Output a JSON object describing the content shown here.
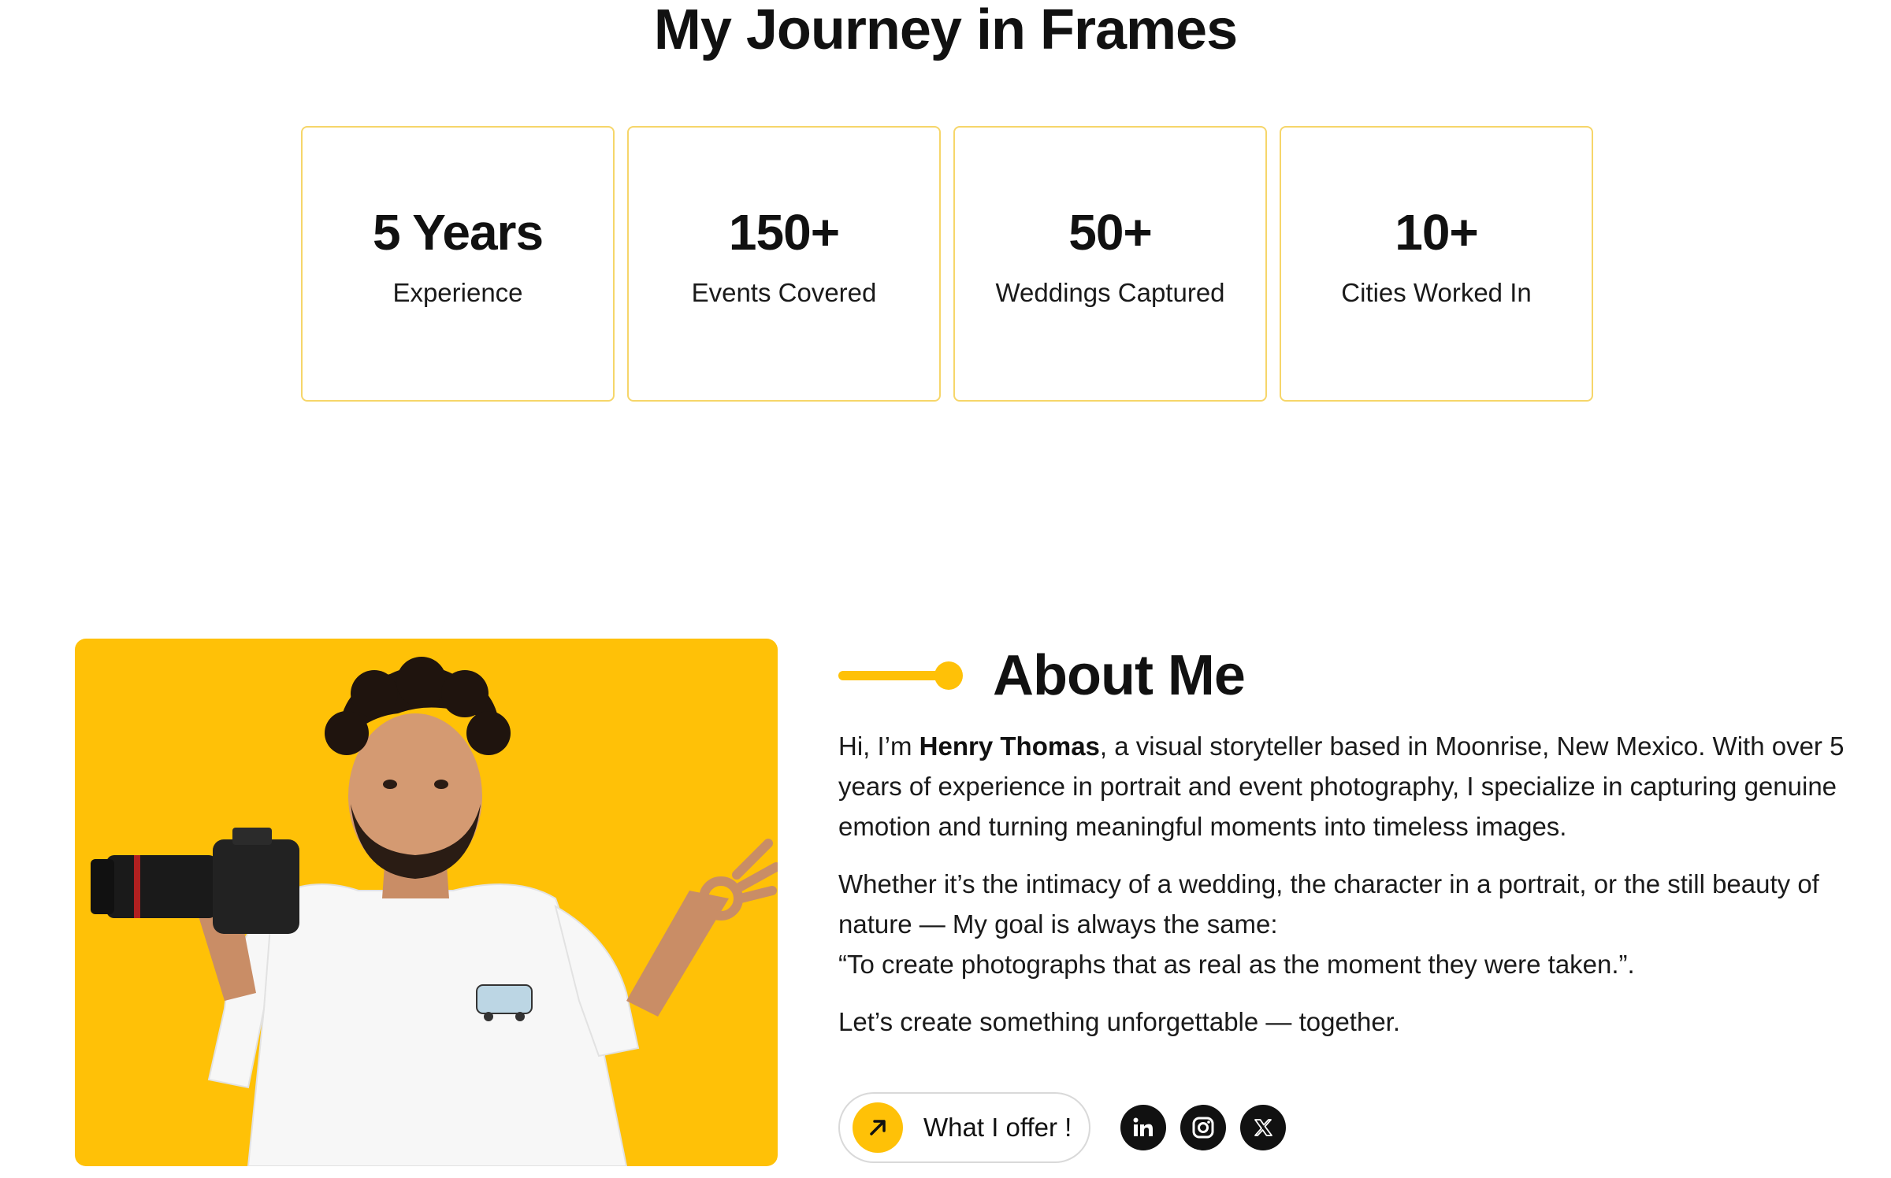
{
  "title": "My Journey in Frames",
  "stats": [
    {
      "value": "5 Years",
      "label": "Experience"
    },
    {
      "value": "150+",
      "label": "Events Covered"
    },
    {
      "value": "50+",
      "label": "Weddings Captured"
    },
    {
      "value": "10+",
      "label": "Cities Worked In"
    }
  ],
  "about": {
    "heading": "About Me",
    "p1_before": "Hi, I’m ",
    "name": "Henry Thomas",
    "p1_after": ", a visual storyteller based in Moonrise, New Mexico. With over 5 years of experience in portrait and event photography, I specialize in capturing genuine emotion and turning meaningful moments into timeless images.",
    "p2_line1": "Whether it’s the intimacy of a wedding, the character in a portrait, or the still beauty of nature — My goal is always the same:",
    "p2_line2": "“To create photographs that as real as the moment they were taken.”.",
    "p3": "Let’s create something unforgettable — together.",
    "offer_label": "What I offer !",
    "offer_icon": "arrow-up-right-icon",
    "socials": [
      "linkedin-icon",
      "instagram-icon",
      "x-icon"
    ]
  },
  "colors": {
    "accent": "#ffc107",
    "card_border": "#f6d66a",
    "text": "#111111"
  }
}
